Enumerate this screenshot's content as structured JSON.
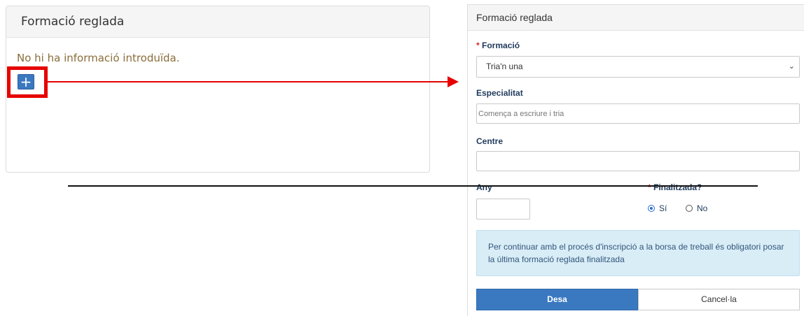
{
  "left_card": {
    "title": "Formació reglada",
    "empty_message": "No hi ha informació introduïda.",
    "add_symbol": "+"
  },
  "form": {
    "title": "Formació reglada",
    "required_mark": "*",
    "formacio": {
      "label": "Formació",
      "selected": "Tria'n una"
    },
    "especialitat": {
      "label": "Especialitat",
      "placeholder": "Comença a escriure i tria"
    },
    "centre": {
      "label": "Centre",
      "value": ""
    },
    "any": {
      "label": "Any",
      "value": ""
    },
    "finalitzada": {
      "label": "Finalitzada?",
      "options": [
        {
          "label": "Sí",
          "selected": true
        },
        {
          "label": "No",
          "selected": false
        }
      ]
    },
    "info_text": "Per continuar amb el procés d'inscripció a la borsa de treball és obligatori posar la última formació reglada finalitzada",
    "save_label": "Desa",
    "cancel_label": "Cancel·la"
  },
  "colors": {
    "annotation_red": "#e60000",
    "primary_blue": "#3a79c0",
    "info_bg": "#d9edf7",
    "warning_text": "#8a6d3b"
  },
  "icons": {
    "select_chevron": "chevron-down-icon",
    "arrow": "arrow-right-icon"
  }
}
